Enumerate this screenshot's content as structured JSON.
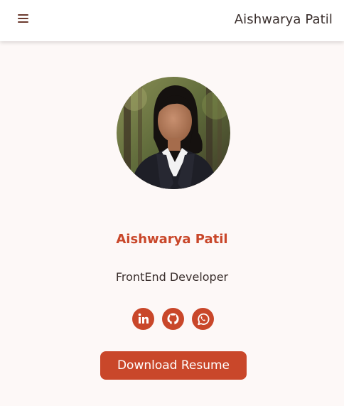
{
  "navbar": {
    "menu_icon": "hamburger-menu-icon",
    "brand": "Aishwarya Patil"
  },
  "hero": {
    "name": "Aishwarya Patil",
    "role": "FrontEnd Developer",
    "photo_icon": "profile-photo"
  },
  "socials": [
    {
      "icon": "linkedin-icon"
    },
    {
      "icon": "github-icon"
    },
    {
      "icon": "whatsapp-icon"
    }
  ],
  "resume_button": {
    "label": "Download Resume"
  },
  "colors": {
    "accent": "#c9472a",
    "background": "#fdf8f7",
    "text": "#3a2f2d",
    "navbar": "#ffffff"
  }
}
